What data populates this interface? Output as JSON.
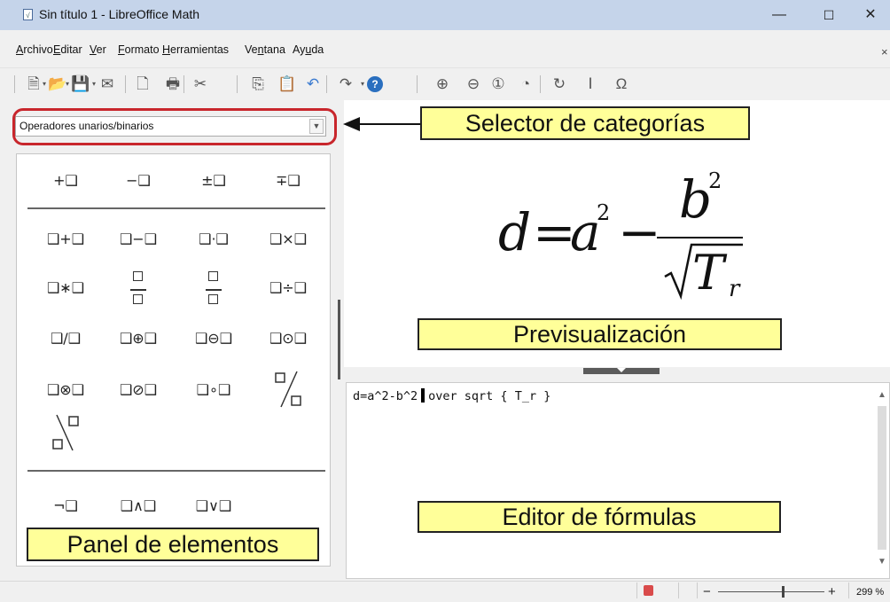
{
  "window": {
    "title": "Sin título 1 - LibreOffice Math",
    "icon": "libreoffice-math-icon",
    "minimize": "—",
    "maximize": "☐",
    "close": "✕"
  },
  "menu": {
    "items": [
      {
        "label": "Archivo",
        "u": "A",
        "rest": "rchivo"
      },
      {
        "label": "Editar",
        "u": "E",
        "rest": "ditar"
      },
      {
        "label": "Ver",
        "u": "V",
        "rest": "er"
      },
      {
        "label": "Formato",
        "u": "F",
        "rest": "ormato"
      },
      {
        "label": "Herramientas",
        "u": "H",
        "rest": "erramientas"
      },
      {
        "label": "Ventana",
        "pre": "Ve",
        "u": "n",
        "rest": "tana"
      },
      {
        "label": "Ayuda",
        "pre": "Ay",
        "u": "u",
        "rest": "da"
      }
    ],
    "close_doc": "×"
  },
  "toolbar": {
    "icons": [
      "new-icon",
      "open-icon",
      "save-icon",
      "email-icon",
      "export-pdf-icon",
      "print-icon",
      "cut-icon",
      "copy-icon",
      "paste-icon",
      "undo-icon",
      "redo-icon",
      "help-icon",
      "zoom-in-icon",
      "zoom-out-icon",
      "zoom-100-icon",
      "show-all-icon",
      "update-icon",
      "formula-cursor-icon",
      "symbols-icon"
    ]
  },
  "elements_panel": {
    "category_selected": "Operadores unarios/binarios",
    "rows": [
      [
        "+❑",
        "−❑",
        "±❑",
        "∓❑"
      ],
      [
        "❑+❑",
        "❑−❑",
        "❑·❑",
        "❑×❑"
      ],
      [
        "❑∗❑",
        "frac",
        "frac",
        "❑÷❑"
      ],
      [
        "❑/❑",
        "❑⊕❑",
        "❑⊖❑",
        "❑⊙❑"
      ],
      [
        "❑⊗❑",
        "❑⊘❑",
        "❑∘❑",
        "wideslash"
      ],
      [
        "widebslash"
      ],
      [
        "¬❑",
        "❑∧❑",
        "❑∨❑"
      ]
    ]
  },
  "preview": {
    "formula": {
      "d": "d",
      "eq": "=",
      "a": "a",
      "a_exp": "2",
      "minus": "−",
      "b": "b",
      "b_exp": "2",
      "T": "T",
      "T_sub": "r"
    }
  },
  "editor": {
    "before_cursor": "d=a^2-b^2",
    "after_cursor": "over sqrt { T_r }"
  },
  "annotations": {
    "selector": "Selector de categorías",
    "preview": "Previsualización",
    "elements": "Panel de elementos",
    "editor": "Editor de fórmulas"
  },
  "statusbar": {
    "zoom_minus": "−",
    "zoom_plus": "+",
    "zoom_level": "299 %",
    "zoom_slider_value": 0.6
  },
  "colors": {
    "titlebar": "#c5d4ea",
    "annotation_fill": "#ffff99",
    "highlight": "#c8262c"
  }
}
